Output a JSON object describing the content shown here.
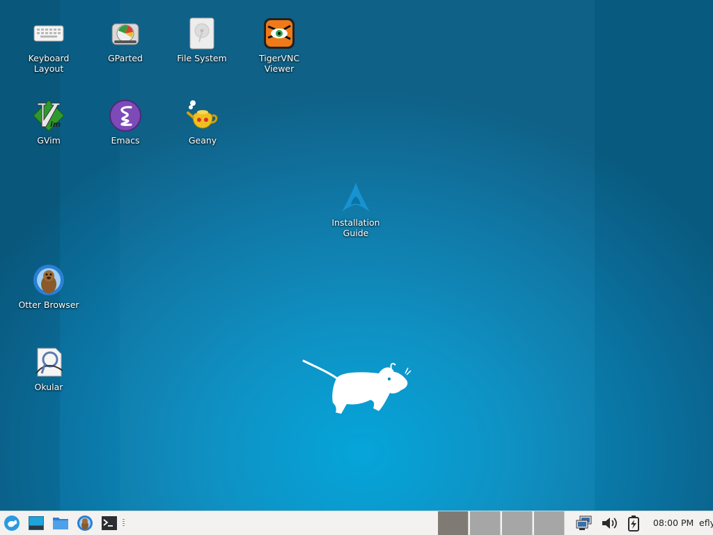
{
  "desktop": {
    "icons": [
      {
        "label": "Keyboard Layout",
        "icon": "keyboard-icon"
      },
      {
        "label": "GParted",
        "icon": "gparted-icon"
      },
      {
        "label": "File System",
        "icon": "harddisk-icon"
      },
      {
        "label": "TigerVNC Viewer",
        "icon": "tigervnc-icon"
      },
      {
        "label": "GVim",
        "icon": "gvim-icon"
      },
      {
        "label": "Emacs",
        "icon": "emacs-icon"
      },
      {
        "label": "Geany",
        "icon": "geany-icon"
      },
      {
        "label": "Installation Guide",
        "icon": "arch-linux-icon"
      },
      {
        "label": "Otter Browser",
        "icon": "otter-browser-icon"
      },
      {
        "label": "Okular",
        "icon": "okular-icon"
      }
    ],
    "wallpaper_colors": {
      "center": "#00a3d9",
      "edge": "#0a5e85"
    }
  },
  "panel": {
    "launchers": [
      "xfce-menu-icon",
      "desktop-show-icon",
      "file-manager-icon",
      "web-browser-icon",
      "terminal-icon"
    ],
    "workspaces": [
      {
        "name": "Workspace 1",
        "active": true
      },
      {
        "name": "Workspace 2",
        "active": false
      },
      {
        "name": "Workspace 3",
        "active": false
      },
      {
        "name": "Workspace 4",
        "active": false
      }
    ],
    "tray": [
      "network-icon",
      "volume-icon",
      "battery-icon"
    ],
    "clock": "08:00 PM",
    "user": "efly"
  }
}
